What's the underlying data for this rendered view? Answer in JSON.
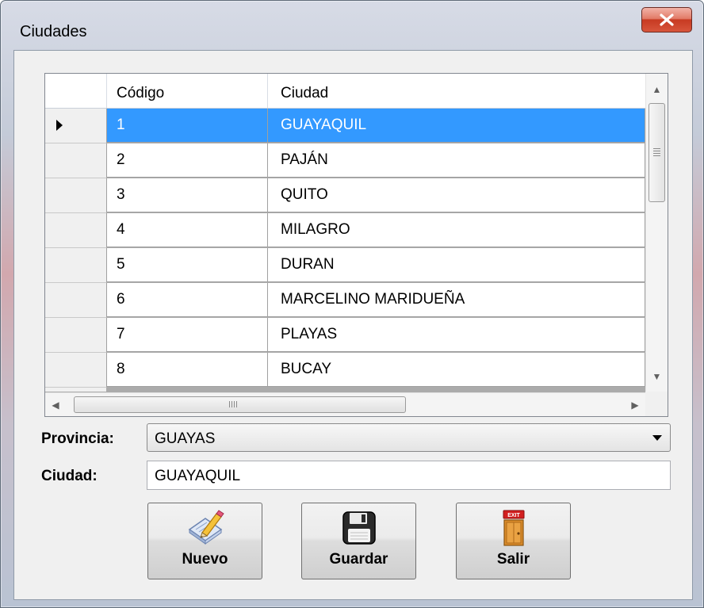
{
  "window": {
    "title": "Ciudades",
    "close_icon": "close-icon"
  },
  "grid": {
    "columns": [
      "Código",
      "Ciudad"
    ],
    "selected_index": 0,
    "rows": [
      {
        "codigo": "1",
        "ciudad": "GUAYAQUIL"
      },
      {
        "codigo": "2",
        "ciudad": "PAJÁN"
      },
      {
        "codigo": "3",
        "ciudad": "QUITO"
      },
      {
        "codigo": "4",
        "ciudad": "MILAGRO"
      },
      {
        "codigo": "5",
        "ciudad": "DURAN"
      },
      {
        "codigo": "6",
        "ciudad": "MARCELINO MARIDUEÑA"
      },
      {
        "codigo": "7",
        "ciudad": "PLAYAS"
      },
      {
        "codigo": "8",
        "ciudad": "BUCAY"
      }
    ]
  },
  "form": {
    "provincia_label": "Provincia:",
    "provincia_value": "GUAYAS",
    "ciudad_label": "Ciudad:",
    "ciudad_value": "GUAYAQUIL"
  },
  "buttons": {
    "nuevo": "Nuevo",
    "guardar": "Guardar",
    "salir": "Salir",
    "exit_sign": "EXIT"
  },
  "colors": {
    "selection": "#3399ff",
    "close_button": "#c73a22"
  }
}
